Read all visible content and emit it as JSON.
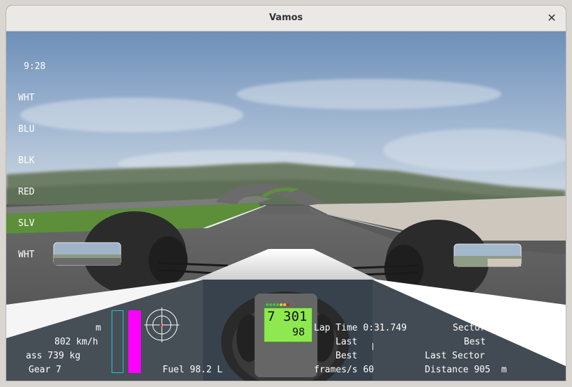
{
  "window": {
    "title": "Vamos",
    "close_glyph": "✕"
  },
  "standings": {
    "clock": "9:28",
    "cars": [
      "WHT",
      "BLU",
      "BLK",
      "RED",
      "SLV",
      "WHT"
    ]
  },
  "dash": {
    "gear_digit": "7",
    "rpm": "301",
    "speed": "98",
    "shift_lights": [
      "#3cc83c",
      "#3cc83c",
      "#3cc83c",
      "#3cc83c",
      "#e8d020",
      "#e8d020",
      "#d02020"
    ]
  },
  "hud": {
    "rpm_partial": "m",
    "speed_partial": "802 km/h",
    "mass": "ass 739 kg",
    "gear": "Gear 7",
    "fuel": "Fuel 98.2 L",
    "lap_time": "Lap Time 0:31.749",
    "last": "Last",
    "best": "Best",
    "frames": "frames/s 60",
    "sector": "Sector",
    "sector_best": "Best",
    "last_sector": "Last Sector",
    "distance": "Distance 905  m"
  },
  "colors": {
    "fuel_bar": "#ff00ff",
    "throttle_outline": "#22c6d8",
    "dash_lcd": "#8ee850"
  }
}
